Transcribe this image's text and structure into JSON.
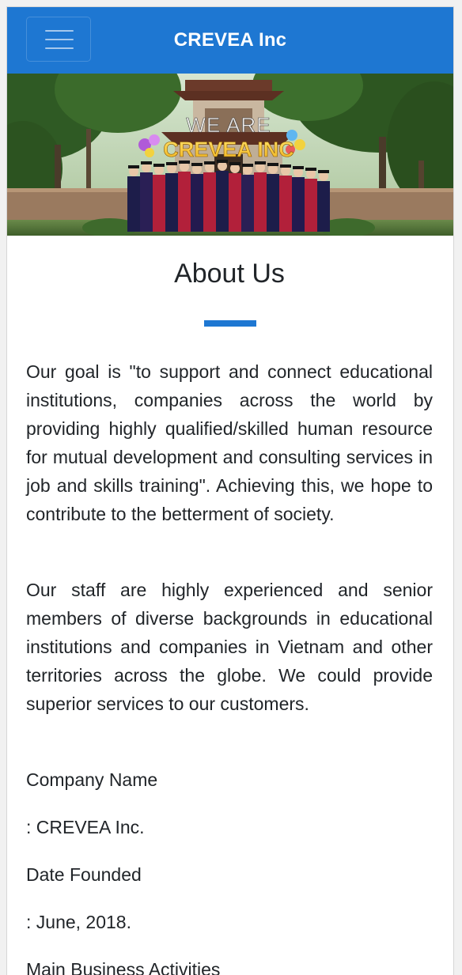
{
  "navbar": {
    "brand": "CREVEA Inc",
    "menu_icon": "hamburger-menu-icon",
    "background_color": "#1e77d2"
  },
  "banner": {
    "overlay_line1": "WE ARE",
    "overlay_line2": "CREVEA INC"
  },
  "about": {
    "heading": "About Us",
    "accent_color": "#1e77d2",
    "paragraph1": "Our goal is \"to support and connect educational institutions, companies across the world by providing highly qualified/skilled human resource for mutual development and consulting services in job and skills training\". Achieving this, we hope to contribute to the betterment of society.",
    "paragraph2": "Our staff are highly experienced and senior members of diverse backgrounds in educational institutions and companies in Vietnam and other territories across the globe. We could provide superior services to our customers.",
    "details": [
      {
        "label": "Company Name",
        "value": ": CREVEA Inc."
      },
      {
        "label": "Date Founded",
        "value": ": June, 2018."
      },
      {
        "label": "Main Business Activities"
      }
    ]
  }
}
